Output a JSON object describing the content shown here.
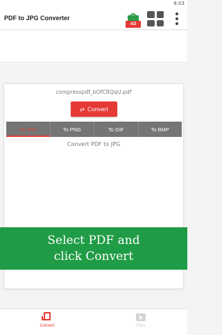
{
  "status_bar": {
    "time": "8:03"
  },
  "app_bar": {
    "title": "PDF to JPG Converter",
    "ad_badge": "AD",
    "icons": [
      "gift-ad-icon",
      "grid-apps-icon",
      "more-vertical-icon"
    ]
  },
  "card": {
    "filename": "compresspdf_bOfCRQqU.pdf",
    "convert_label": "Convert",
    "convert_icon": "shuffle-icon",
    "tabs": [
      {
        "label": "To JPG",
        "active": true
      },
      {
        "label": "To PNG",
        "active": false
      },
      {
        "label": "To GIF",
        "active": false
      },
      {
        "label": "To BMP",
        "active": false
      }
    ],
    "hint": "Convert PDF to JPG"
  },
  "overlay": {
    "line1": "Select PDF and",
    "line2": "click Convert",
    "background": "#1f9c45"
  },
  "bottom_nav": {
    "items": [
      {
        "label": "Convert",
        "active": true,
        "icon": "convert-icon"
      },
      {
        "label": "Files",
        "active": false,
        "icon": "files-icon"
      }
    ]
  },
  "colors": {
    "accent": "#e53935",
    "tab_bar": "#757575",
    "overlay_green": "#1f9c45"
  }
}
